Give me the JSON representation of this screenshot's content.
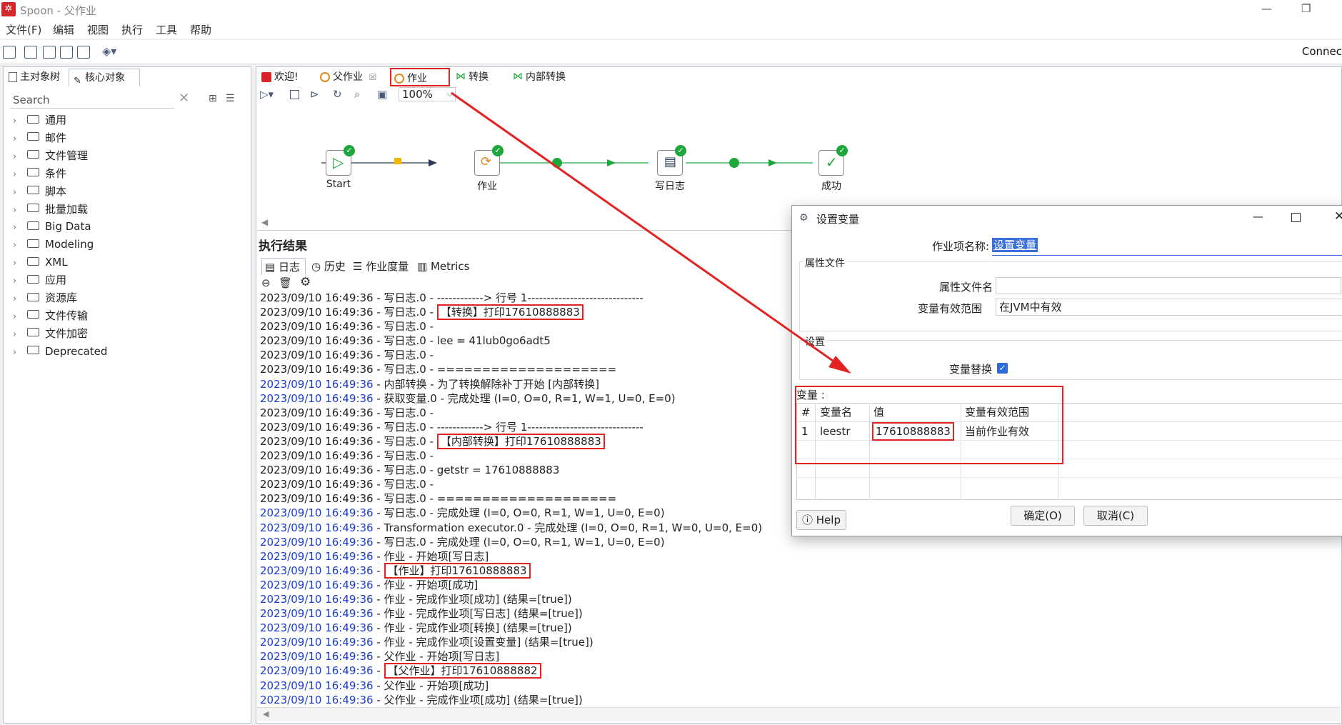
{
  "window": {
    "title": "Spoon - 父作业",
    "logo": "spoon-icon"
  },
  "menu": [
    "文件(F)",
    "编辑",
    "视图",
    "执行",
    "工具",
    "帮助"
  ],
  "toolbar": {
    "connect": "Connec"
  },
  "left_panel": {
    "tabs": [
      "主对象树",
      "核心对象"
    ],
    "search_placeholder": "Search",
    "tree": [
      "通用",
      "邮件",
      "文件管理",
      "条件",
      "脚本",
      "批量加载",
      "Big Data",
      "Modeling",
      "XML",
      "应用",
      "资源库",
      "文件传输",
      "文件加密",
      "Deprecated"
    ]
  },
  "main_tabs": [
    {
      "label": "欢迎!",
      "icon": "welcome-icon",
      "color": "#d6262a"
    },
    {
      "label": "父作业",
      "icon": "job-icon",
      "color": "#e08a1e",
      "close": "☒"
    },
    {
      "label": "作业",
      "icon": "job-icon",
      "color": "#e08a1e"
    },
    {
      "label": "转换",
      "icon": "transform-icon",
      "color": "#1ea83c"
    },
    {
      "label": "内部转换",
      "icon": "transform-icon",
      "color": "#1ea83c"
    }
  ],
  "canvas": {
    "zoom": "100%",
    "nodes": [
      {
        "label": "Start",
        "icon": "start-icon"
      },
      {
        "label": "作业",
        "icon": "job-icon"
      },
      {
        "label": "写日志",
        "icon": "write-log-icon"
      },
      {
        "label": "成功",
        "icon": "success-icon"
      }
    ]
  },
  "results": {
    "title": "执行结果",
    "tabs": [
      "日志",
      "历史",
      "作业度量",
      "Metrics"
    ],
    "log": [
      {
        "ts": "2023/09/10 16:49:36",
        "blue": false,
        "msg": " - 写日志.0 - ------------> 行号 1------------------------------"
      },
      {
        "ts": "2023/09/10 16:49:36",
        "blue": false,
        "msg": " - 写日志.0 - ",
        "box": "【转换】打印17610888883"
      },
      {
        "ts": "2023/09/10 16:49:36",
        "blue": false,
        "msg": " - 写日志.0 - "
      },
      {
        "ts": "2023/09/10 16:49:36",
        "blue": false,
        "msg": " - 写日志.0 - lee = 41lub0go6adt5"
      },
      {
        "ts": "2023/09/10 16:49:36",
        "blue": false,
        "msg": " - 写日志.0 - "
      },
      {
        "ts": "2023/09/10 16:49:36",
        "blue": false,
        "msg": " - 写日志.0 - ===================="
      },
      {
        "ts": "2023/09/10 16:49:36",
        "blue": true,
        "msg": " - 内部转换 - 为了转换解除补丁开始  [内部转换]"
      },
      {
        "ts": "2023/09/10 16:49:36",
        "blue": true,
        "msg": " - 获取变量.0 - 完成处理 (I=0, O=0, R=1, W=1, U=0, E=0)"
      },
      {
        "ts": "2023/09/10 16:49:36",
        "blue": false,
        "msg": " - 写日志.0 - "
      },
      {
        "ts": "2023/09/10 16:49:36",
        "blue": false,
        "msg": " - 写日志.0 - ------------> 行号 1------------------------------"
      },
      {
        "ts": "2023/09/10 16:49:36",
        "blue": false,
        "msg": " - 写日志.0 - ",
        "box": "【内部转换】打印17610888883"
      },
      {
        "ts": "2023/09/10 16:49:36",
        "blue": false,
        "msg": " - 写日志.0 - "
      },
      {
        "ts": "2023/09/10 16:49:36",
        "blue": false,
        "msg": " - 写日志.0 - getstr = 17610888883"
      },
      {
        "ts": "2023/09/10 16:49:36",
        "blue": false,
        "msg": " - 写日志.0 - "
      },
      {
        "ts": "2023/09/10 16:49:36",
        "blue": false,
        "msg": " - 写日志.0 - ===================="
      },
      {
        "ts": "2023/09/10 16:49:36",
        "blue": true,
        "msg": " - 写日志.0 - 完成处理 (I=0, O=0, R=1, W=1, U=0, E=0)"
      },
      {
        "ts": "2023/09/10 16:49:36",
        "blue": true,
        "msg": " - Transformation executor.0 - 完成处理 (I=0, O=0, R=1, W=0, U=0, E=0)"
      },
      {
        "ts": "2023/09/10 16:49:36",
        "blue": true,
        "msg": " - 写日志.0 - 完成处理 (I=0, O=0, R=1, W=1, U=0, E=0)"
      },
      {
        "ts": "2023/09/10 16:49:36",
        "blue": true,
        "msg": " - 作业 - 开始项[写日志]"
      },
      {
        "ts": "2023/09/10 16:49:36",
        "blue": true,
        "msg": " - ",
        "box": "【作业】打印17610888883"
      },
      {
        "ts": "2023/09/10 16:49:36",
        "blue": true,
        "msg": " - 作业 - 开始项[成功]"
      },
      {
        "ts": "2023/09/10 16:49:36",
        "blue": true,
        "msg": " - 作业 - 完成作业项[成功] (结果=[true])"
      },
      {
        "ts": "2023/09/10 16:49:36",
        "blue": true,
        "msg": " - 作业 - 完成作业项[写日志] (结果=[true])"
      },
      {
        "ts": "2023/09/10 16:49:36",
        "blue": true,
        "msg": " - 作业 - 完成作业项[转换] (结果=[true])"
      },
      {
        "ts": "2023/09/10 16:49:36",
        "blue": true,
        "msg": " - 作业 - 完成作业项[设置变量] (结果=[true])"
      },
      {
        "ts": "2023/09/10 16:49:36",
        "blue": true,
        "msg": " - 父作业 - 开始项[写日志]"
      },
      {
        "ts": "2023/09/10 16:49:36",
        "blue": true,
        "msg": " - ",
        "box": "【父作业】打印17610888882"
      },
      {
        "ts": "2023/09/10 16:49:36",
        "blue": true,
        "msg": " - 父作业 - 开始项[成功]"
      },
      {
        "ts": "2023/09/10 16:49:36",
        "blue": true,
        "msg": " - 父作业 - 完成作业项[成功] (结果=[true])"
      }
    ]
  },
  "dialog": {
    "title": "设置变量",
    "job_name_label": "作业项名称:",
    "job_name_value": "设置变量",
    "property_file_group": "属性文件",
    "property_file_label": "属性文件名",
    "scope_label": "变量有效范围",
    "scope_value": "在JVM中有效",
    "settings_group": "设置",
    "var_replace_label": "变量替换",
    "var_replace_checked": true,
    "variables_label": "变量 :",
    "grid_headers": [
      "#",
      "变量名",
      "值",
      "变量有效范围"
    ],
    "grid_rows": [
      {
        "num": "1",
        "name": "leestr",
        "value": "17610888883",
        "scope": "当前作业有效"
      }
    ],
    "help": "Help",
    "ok": "确定(O)",
    "cancel": "取消(C)"
  },
  "colors": {
    "accent_red": "#e52222",
    "ok_green": "#1ea83c",
    "log_blue": "#1a3ccc"
  }
}
